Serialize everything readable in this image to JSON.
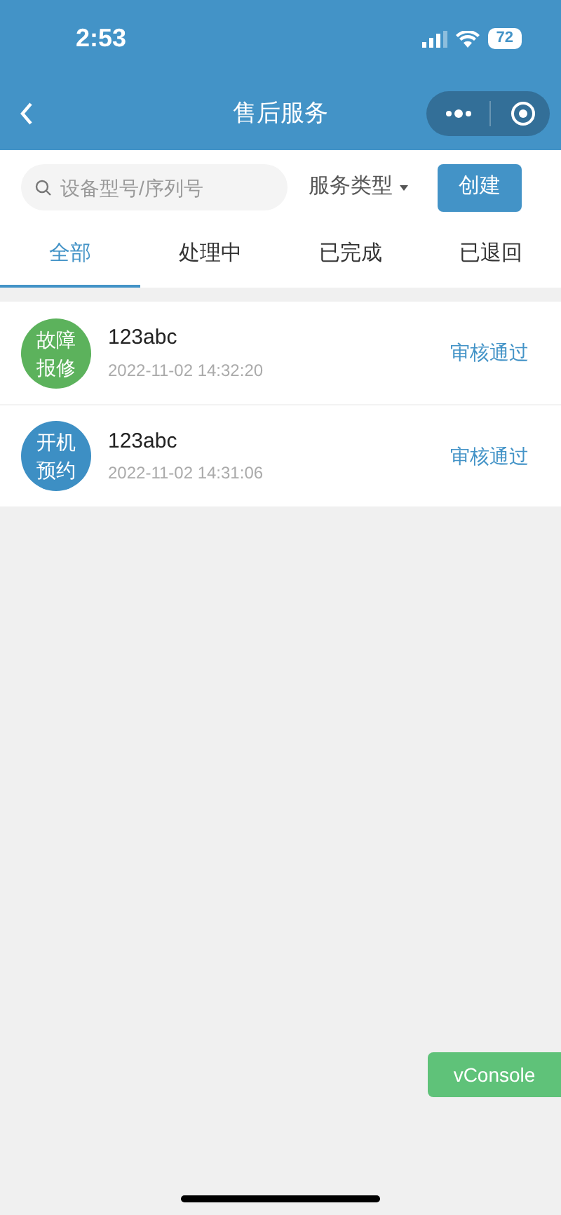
{
  "status_bar": {
    "time": "2:53",
    "battery": "72"
  },
  "nav": {
    "title": "售后服务"
  },
  "toolbar": {
    "search": {
      "placeholder": "设备型号/序列号"
    },
    "filter": "服务类型",
    "create_button": "创建"
  },
  "tabs": [
    {
      "label": "全部",
      "selected": true
    },
    {
      "label": "处理中",
      "selected": false
    },
    {
      "label": "已完成",
      "selected": false
    },
    {
      "label": "已退回",
      "selected": false
    }
  ],
  "records": [
    {
      "badge": [
        "故障",
        "报修"
      ],
      "color": "#5cb25c",
      "name": "123abc",
      "time": "2022-11-02 14:32:20",
      "status": "审核通过"
    },
    {
      "badge": [
        "开机",
        "预约"
      ],
      "color": "#3d8fc4",
      "name": "123abc",
      "time": "2022-11-02 14:31:06",
      "status": "审核通过"
    }
  ],
  "vconsole": "vConsole"
}
